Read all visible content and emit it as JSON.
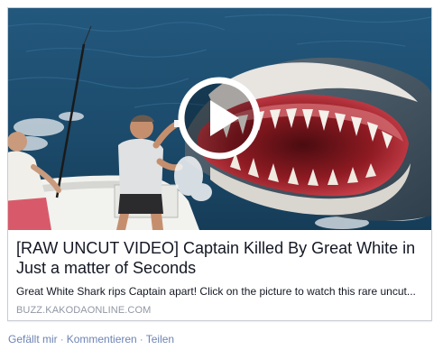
{
  "post": {
    "title": "[RAW UNCUT VIDEO] Captain Killed By Great White in Just a matter of Seconds",
    "description": "Great White Shark rips Captain apart! Click on the picture to watch this rare uncut...",
    "domain": "BUZZ.KAKODAONLINE.COM",
    "thumbnail_icon": "play-button-icon"
  },
  "actions": {
    "like": "Gefällt mir",
    "separator": "·",
    "comment": "Kommentieren",
    "share": "Teilen"
  },
  "colors": {
    "title": "#141823",
    "domain": "#9197a3",
    "action_link": "#6d84b4",
    "card_border": "#c8ccd4"
  }
}
